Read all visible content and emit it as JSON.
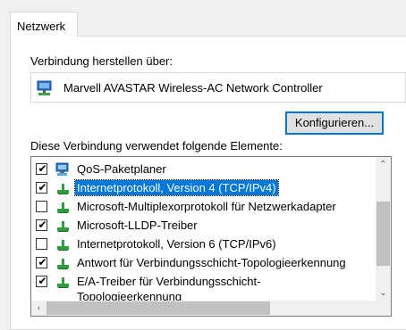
{
  "tab": {
    "label": "Netzwerk"
  },
  "connect_label": "Verbindung herstellen über:",
  "adapter": {
    "name": "Marvell AVASTAR Wireless-AC Network Controller",
    "icon": "network-adapter-icon"
  },
  "configure_button": "Konfigurieren...",
  "uses_label": "Diese Verbindung verwendet folgende Elemente:",
  "items": [
    {
      "label": "QoS-Paketplaner",
      "checked": true,
      "icon": "qos-service-icon",
      "selected": false
    },
    {
      "label": "Internetprotokoll, Version 4 (TCP/IPv4)",
      "checked": true,
      "icon": "protocol-icon",
      "selected": true
    },
    {
      "label": "Microsoft-Multiplexorprotokoll für Netzwerkadapter",
      "checked": false,
      "icon": "protocol-icon",
      "selected": false
    },
    {
      "label": "Microsoft-LLDP-Treiber",
      "checked": true,
      "icon": "protocol-icon",
      "selected": false
    },
    {
      "label": "Internetprotokoll, Version 6 (TCP/IPv6)",
      "checked": false,
      "icon": "protocol-icon",
      "selected": false
    },
    {
      "label": "Antwort für Verbindungsschicht-Topologieerkennung",
      "checked": true,
      "icon": "protocol-icon",
      "selected": false
    },
    {
      "label": "E/A-Treiber für Verbindungsschicht-Topologieerkennung",
      "checked": true,
      "icon": "protocol-icon",
      "selected": false
    }
  ],
  "colors": {
    "selection": "#0078d7",
    "protocol_green": "#2e9e3e"
  }
}
